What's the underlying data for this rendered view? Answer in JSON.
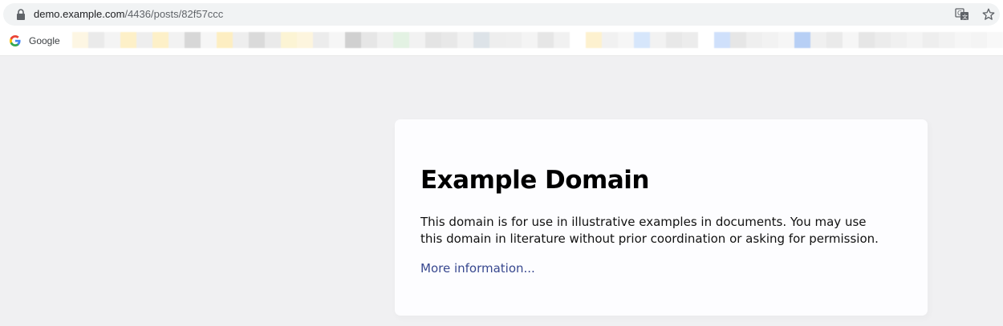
{
  "browser": {
    "url_host": "demo.example.com",
    "url_path": "/4436/posts/82f57ccc",
    "icons": {
      "lock": "lock-icon",
      "translate": "translate-icon",
      "bookmark_star": "star-icon"
    },
    "bookmarks": [
      {
        "label": "Google",
        "icon": "google-icon"
      }
    ]
  },
  "page": {
    "title": "Example Domain",
    "description": "This domain is for use in illustrative examples in documents. You may use this domain in literature without prior coordination or asking for permission.",
    "link_label": "More information...",
    "colors": {
      "background": "#f0f0f2",
      "card": "#fdfdff",
      "link": "#38488f"
    }
  }
}
